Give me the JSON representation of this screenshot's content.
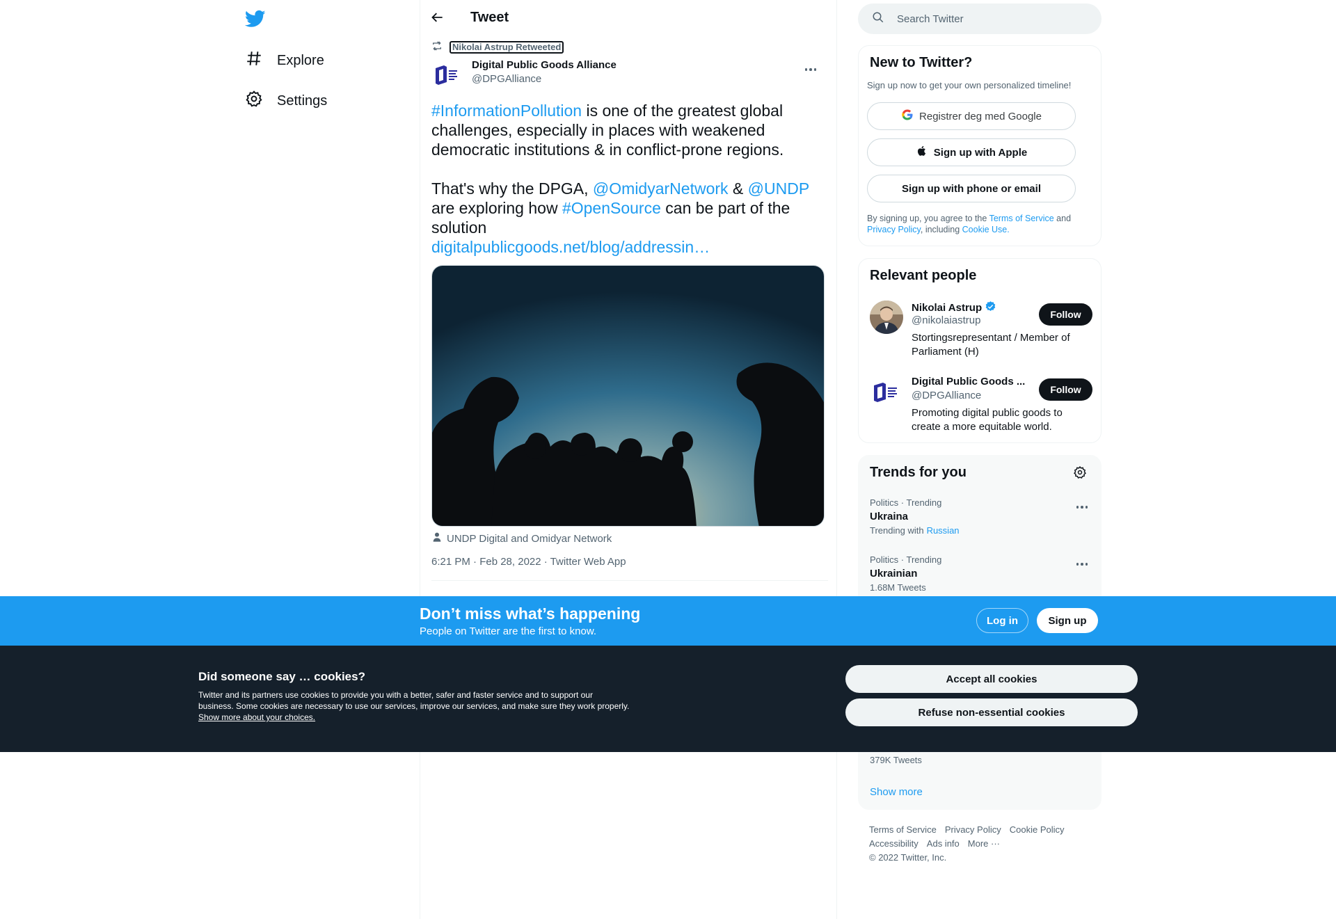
{
  "colors": {
    "accent": "#1d9bf0",
    "text": "#0f1419",
    "muted": "#536471",
    "cookie_bg": "#15202b"
  },
  "nav": {
    "logo": "twitter-bird-icon",
    "items": [
      {
        "label": "Explore",
        "icon": "hashtag-icon"
      },
      {
        "label": "Settings",
        "icon": "gear-icon"
      }
    ]
  },
  "header": {
    "title": "Tweet",
    "back_icon": "arrow-left-icon"
  },
  "tweet": {
    "retweeted_by": "Nikolai Astrup Retweeted",
    "author_name": "Digital Public Goods Alliance",
    "author_handle": "@DPGAlliance",
    "text": {
      "p1_hashtag": "#InformationPollution",
      "p1_rest": " is one of the greatest global challenges, especially in places with weakened democratic institutions & in conflict-prone regions.",
      "p2_start": "That's why the DPGA, ",
      "p2_mention1": "@OmidyarNetwork",
      "p2_amp": " & ",
      "p2_mention2": "@UNDP",
      "p2_mid": " are exploring how ",
      "p2_hashtag": "#OpenSource",
      "p2_end": " can be part of the solution",
      "link": "digitalpublicgoods.net/blog/addressin…"
    },
    "media_caption": "UNDP Digital and Omidyar Network",
    "timestamp": "6:21 PM · Feb 28, 2022 · Twitter Web App"
  },
  "search": {
    "placeholder": "Search Twitter"
  },
  "new_to_twitter": {
    "title": "New to Twitter?",
    "subtitle": "Sign up now to get your own personalized timeline!",
    "google": "Registrer deg med Google",
    "apple": "Sign up with Apple",
    "phone": "Sign up with phone or email",
    "legal_prefix": "By signing up, you agree to the ",
    "terms": "Terms of Service",
    "and": " and",
    "privacy": "Privacy Policy",
    "including": ", including ",
    "cookie_use": "Cookie Use."
  },
  "relevant_people": {
    "title": "Relevant people",
    "people": [
      {
        "name": "Nikolai Astrup",
        "handle": "@nikolaiastrup",
        "bio": "Stortingsrepresentant / Member of Parliament (H)",
        "follow": "Follow",
        "verified": true
      },
      {
        "name": "Digital Public Goods ...",
        "handle": "@DPGAlliance",
        "bio": "Promoting digital public goods to create a more equitable world.",
        "follow": "Follow",
        "verified": false
      }
    ]
  },
  "trends": {
    "title": "Trends for you",
    "items": [
      {
        "category": "Politics · Trending",
        "name": "Ukraina",
        "meta_prefix": "Trending with",
        "meta_link": "Russian"
      },
      {
        "category": "Politics · Trending",
        "name": "Ukrainian",
        "meta": "1.68M Tweets"
      }
    ],
    "extra_meta": "379K Tweets",
    "show_more": "Show more"
  },
  "footer": {
    "links": [
      "Terms of Service",
      "Privacy Policy",
      "Cookie Policy",
      "Accessibility",
      "Ads info",
      "More ···"
    ],
    "copyright": "© 2022 Twitter, Inc."
  },
  "banner": {
    "title": "Don’t miss what’s happening",
    "subtitle": "People on Twitter are the first to know.",
    "login": "Log in",
    "signup": "Sign up"
  },
  "cookies": {
    "title": "Did someone say … cookies?",
    "text": "Twitter and its partners use cookies to provide you with a better, safer and faster service and to support our business. Some cookies are necessary to use our services, improve our services, and make sure they work properly. ",
    "link": "Show more about your choices.",
    "accept": "Accept all cookies",
    "refuse": "Refuse non-essential cookies"
  }
}
